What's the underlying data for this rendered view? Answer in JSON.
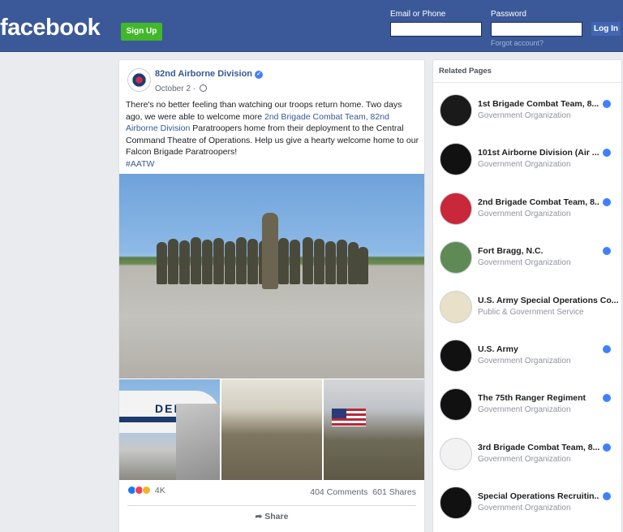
{
  "header": {
    "logo": "facebook",
    "signup_label": "Sign Up",
    "email_label": "Email or Phone",
    "password_label": "Password",
    "login_label": "Log In",
    "forgot_label": "Forgot account?"
  },
  "post": {
    "page_name": "82nd Airborne Division",
    "date": "October 2 ·",
    "text_1": "There's no better feeling than watching our troops return home. Two days ago, we were able to welcome more ",
    "text_link": "2nd Brigade Combat Team, 82nd Airborne Division",
    "text_2": " Paratroopers home from their deployment to the Central Command Theatre of Operations. Help us give a hearty welcome home to our Falcon Brigade Paratroopers!",
    "hashtag": "#AATW",
    "plane_text": "DELT",
    "reaction_count": "4K",
    "comments": "404 Comments",
    "shares": "601 Shares",
    "share_label": "Share"
  },
  "related": {
    "title": "Related Pages",
    "items": [
      {
        "name": "1st Brigade Combat Team, 8...",
        "category": "Government Organization",
        "verified": true,
        "color": "#1a1a1a"
      },
      {
        "name": "101st Airborne Division (Air ...",
        "category": "Government Organization",
        "verified": true,
        "color": "#111111"
      },
      {
        "name": "2nd Brigade Combat Team, 8...",
        "category": "Government Organization",
        "verified": true,
        "color": "#c8283a"
      },
      {
        "name": "Fort Bragg, N.C.",
        "category": "Government Organization",
        "verified": true,
        "color": "#5f8a55"
      },
      {
        "name": "U.S. Army Special Operations Co...",
        "category": "Public & Government Service",
        "verified": false,
        "color": "#e8e0c8"
      },
      {
        "name": "U.S. Army",
        "category": "Government Organization",
        "verified": true,
        "color": "#111111"
      },
      {
        "name": "The 75th Ranger Regiment",
        "category": "Government Organization",
        "verified": true,
        "color": "#111111"
      },
      {
        "name": "3rd Brigade Combat Team, 8...",
        "category": "Government Organization",
        "verified": true,
        "color": "#f2f2f2"
      },
      {
        "name": "Special Operations Recruitin...",
        "category": "Government Organization",
        "verified": true,
        "color": "#111111"
      }
    ]
  }
}
